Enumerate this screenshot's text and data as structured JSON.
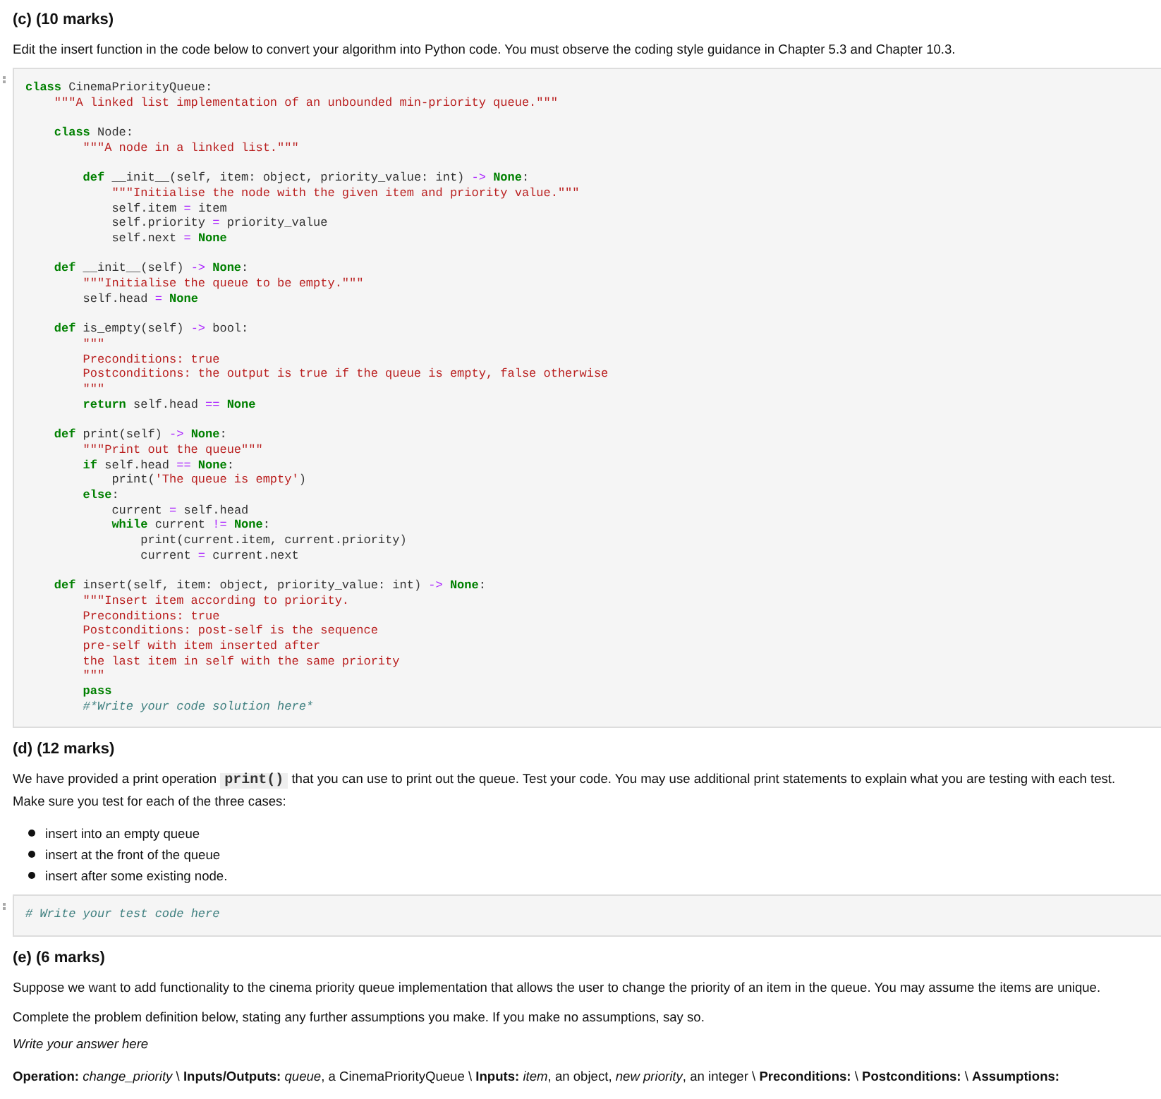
{
  "sections": [
    {
      "heading": "(c) (10 marks)",
      "paragraph": "Edit the insert function in the code below to convert your algorithm into Python code. You must observe the coding style guidance in Chapter 5.3 and Chapter 10.3.",
      "code_cell": {
        "lines": [
          {
            "tokens": [
              {
                "kind": "keyword",
                "text": "class"
              },
              {
                "kind": "plain",
                "text": " CinemaPriorityQueue:"
              }
            ],
            "children": [
              {
                "tokens": [
                  {
                    "kind": "string",
                    "text": "\"\"\"A linked list implementation of an unbounded min-priority queue.\"\"\""
                  }
                ]
              },
              {
                "blank_before": true,
                "tokens": [
                  {
                    "kind": "keyword",
                    "text": "class"
                  },
                  {
                    "kind": "plain",
                    "text": " Node:"
                  }
                ],
                "children": [
                  {
                    "tokens": [
                      {
                        "kind": "string",
                        "text": "\"\"\"A node in a linked list.\"\"\""
                      }
                    ]
                  },
                  {
                    "blank_before": true,
                    "tokens": [
                      {
                        "kind": "keyword",
                        "text": "def"
                      },
                      {
                        "kind": "plain",
                        "text": " __init__(self, item: object, priority_value: int)"
                      },
                      {
                        "kind": "operator",
                        "text": " -> "
                      },
                      {
                        "kind": "keyword",
                        "text": "None"
                      },
                      {
                        "kind": "plain",
                        "text": ":"
                      }
                    ],
                    "children": [
                      {
                        "tokens": [
                          {
                            "kind": "string",
                            "text": "\"\"\"Initialise the node with the given item and priority value.\"\"\""
                          }
                        ]
                      },
                      {
                        "tokens": [
                          {
                            "kind": "plain",
                            "text": "self.item"
                          },
                          {
                            "kind": "operator",
                            "text": " = "
                          },
                          {
                            "kind": "plain",
                            "text": "item"
                          }
                        ]
                      },
                      {
                        "tokens": [
                          {
                            "kind": "plain",
                            "text": "self.priority"
                          },
                          {
                            "kind": "operator",
                            "text": " = "
                          },
                          {
                            "kind": "plain",
                            "text": "priority_value"
                          }
                        ]
                      },
                      {
                        "tokens": [
                          {
                            "kind": "plain",
                            "text": "self.next"
                          },
                          {
                            "kind": "operator",
                            "text": " = "
                          },
                          {
                            "kind": "keyword",
                            "text": "None"
                          }
                        ]
                      }
                    ]
                  }
                ]
              },
              {
                "blank_before": true,
                "tokens": [
                  {
                    "kind": "keyword",
                    "text": "def"
                  },
                  {
                    "kind": "plain",
                    "text": " __init__(self)"
                  },
                  {
                    "kind": "operator",
                    "text": " -> "
                  },
                  {
                    "kind": "keyword",
                    "text": "None"
                  },
                  {
                    "kind": "plain",
                    "text": ":"
                  }
                ],
                "children": [
                  {
                    "tokens": [
                      {
                        "kind": "string",
                        "text": "\"\"\"Initialise the queue to be empty.\"\"\""
                      }
                    ]
                  },
                  {
                    "tokens": [
                      {
                        "kind": "plain",
                        "text": "self.head"
                      },
                      {
                        "kind": "operator",
                        "text": " = "
                      },
                      {
                        "kind": "keyword",
                        "text": "None"
                      }
                    ]
                  }
                ]
              },
              {
                "blank_before": true,
                "tokens": [
                  {
                    "kind": "keyword",
                    "text": "def"
                  },
                  {
                    "kind": "plain",
                    "text": " is_empty(self)"
                  },
                  {
                    "kind": "operator",
                    "text": " -> "
                  },
                  {
                    "kind": "plain",
                    "text": "bool:"
                  }
                ],
                "children": [
                  {
                    "tokens": [
                      {
                        "kind": "string",
                        "text": "\"\"\""
                      }
                    ]
                  },
                  {
                    "tokens": [
                      {
                        "kind": "string",
                        "text": "Preconditions: true"
                      }
                    ]
                  },
                  {
                    "tokens": [
                      {
                        "kind": "string",
                        "text": "Postconditions: the output is true if the queue is empty, false otherwise"
                      }
                    ]
                  },
                  {
                    "tokens": [
                      {
                        "kind": "string",
                        "text": "\"\"\""
                      }
                    ]
                  },
                  {
                    "tokens": [
                      {
                        "kind": "keyword",
                        "text": "return"
                      },
                      {
                        "kind": "plain",
                        "text": " self.head"
                      },
                      {
                        "kind": "operator",
                        "text": " == "
                      },
                      {
                        "kind": "keyword",
                        "text": "None"
                      }
                    ]
                  }
                ]
              },
              {
                "blank_before": true,
                "tokens": [
                  {
                    "kind": "keyword",
                    "text": "def"
                  },
                  {
                    "kind": "plain",
                    "text": " print(self)"
                  },
                  {
                    "kind": "operator",
                    "text": " -> "
                  },
                  {
                    "kind": "keyword",
                    "text": "None"
                  },
                  {
                    "kind": "plain",
                    "text": ":"
                  }
                ],
                "children": [
                  {
                    "tokens": [
                      {
                        "kind": "string",
                        "text": "\"\"\"Print out the queue\"\"\""
                      }
                    ]
                  },
                  {
                    "tokens": [
                      {
                        "kind": "keyword",
                        "text": "if"
                      },
                      {
                        "kind": "plain",
                        "text": " self.head"
                      },
                      {
                        "kind": "operator",
                        "text": " == "
                      },
                      {
                        "kind": "keyword",
                        "text": "None"
                      },
                      {
                        "kind": "plain",
                        "text": ":"
                      }
                    ],
                    "children": [
                      {
                        "tokens": [
                          {
                            "kind": "plain",
                            "text": "print("
                          },
                          {
                            "kind": "string",
                            "text": "'The queue is empty'"
                          },
                          {
                            "kind": "plain",
                            "text": ")"
                          }
                        ]
                      }
                    ]
                  },
                  {
                    "tokens": [
                      {
                        "kind": "keyword",
                        "text": "else"
                      },
                      {
                        "kind": "plain",
                        "text": ":"
                      }
                    ],
                    "children": [
                      {
                        "tokens": [
                          {
                            "kind": "plain",
                            "text": "current"
                          },
                          {
                            "kind": "operator",
                            "text": " = "
                          },
                          {
                            "kind": "plain",
                            "text": "self.head"
                          }
                        ]
                      },
                      {
                        "tokens": [
                          {
                            "kind": "keyword",
                            "text": "while"
                          },
                          {
                            "kind": "plain",
                            "text": " current"
                          },
                          {
                            "kind": "operator",
                            "text": " != "
                          },
                          {
                            "kind": "keyword",
                            "text": "None"
                          },
                          {
                            "kind": "plain",
                            "text": ":"
                          }
                        ],
                        "children": [
                          {
                            "tokens": [
                              {
                                "kind": "plain",
                                "text": "print(current.item, current.priority)"
                              }
                            ]
                          },
                          {
                            "tokens": [
                              {
                                "kind": "plain",
                                "text": "current"
                              },
                              {
                                "kind": "operator",
                                "text": " = "
                              },
                              {
                                "kind": "plain",
                                "text": "current.next"
                              }
                            ]
                          }
                        ]
                      }
                    ]
                  }
                ]
              },
              {
                "blank_before": true,
                "tokens": [
                  {
                    "kind": "keyword",
                    "text": "def"
                  },
                  {
                    "kind": "plain",
                    "text": " insert(self, item: object, priority_value: int)"
                  },
                  {
                    "kind": "operator",
                    "text": " -> "
                  },
                  {
                    "kind": "keyword",
                    "text": "None"
                  },
                  {
                    "kind": "plain",
                    "text": ":"
                  }
                ],
                "children": [
                  {
                    "tokens": [
                      {
                        "kind": "string",
                        "text": "\"\"\"Insert item according to priority."
                      }
                    ]
                  },
                  {
                    "tokens": [
                      {
                        "kind": "string",
                        "text": "Preconditions: true"
                      }
                    ]
                  },
                  {
                    "tokens": [
                      {
                        "kind": "string",
                        "text": "Postconditions: post-self is the sequence"
                      }
                    ]
                  },
                  {
                    "tokens": [
                      {
                        "kind": "string",
                        "text": "pre-self with item inserted after"
                      }
                    ]
                  },
                  {
                    "tokens": [
                      {
                        "kind": "string",
                        "text": "the last item in self with the same priority"
                      }
                    ]
                  },
                  {
                    "tokens": [
                      {
                        "kind": "string",
                        "text": "\"\"\""
                      }
                    ]
                  },
                  {
                    "tokens": [
                      {
                        "kind": "keyword",
                        "text": "pass"
                      }
                    ]
                  },
                  {
                    "tokens": [
                      {
                        "kind": "comment",
                        "text": "#*Write your code solution here*"
                      }
                    ]
                  }
                ]
              }
            ]
          }
        ]
      }
    },
    {
      "heading": "(d) (12 marks)",
      "paragraph_parts": {
        "before": "We have provided a print operation",
        "code": "print()",
        "after": "that you can use to print out the queue. Test your code. You may use additional print statements to explain what you are testing with each test. Make sure you test for each of the three cases:"
      },
      "bullets": [
        "insert into an empty queue",
        "insert at the front of the queue",
        "insert after some existing node."
      ],
      "code_cell": {
        "lines": [
          {
            "tokens": [
              {
                "kind": "comment",
                "text": "# Write your test code here"
              }
            ]
          }
        ]
      }
    },
    {
      "heading": "(e) (6 marks)",
      "paragraphs": [
        "Suppose we want to add functionality to the cinema priority queue implementation that allows the user to change the priority of an item in the queue. You may assume the items are unique.",
        "Complete the problem definition below, stating any further assumptions you make. If you make no assumptions, say so."
      ],
      "answer_prompt": "Write your answer here",
      "definition": "**Operation:** *change_priority* \\ **Inputs/Outputs:** *queue*, a CinemaPriorityQueue \\ **Inputs:** *item*, an object, *new priority*, an integer \\ **Preconditions:** \\ **Postconditions:** \\ **Assumptions:**"
    }
  ]
}
